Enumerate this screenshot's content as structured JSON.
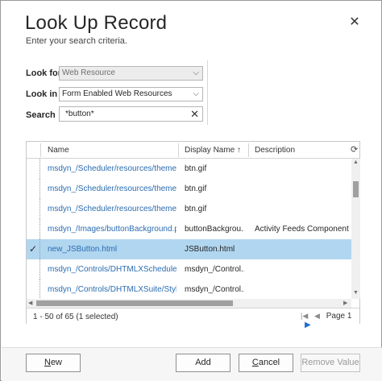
{
  "dialog": {
    "title": "Look Up Record",
    "subtitle": "Enter your search criteria.",
    "close_icon": "close-icon"
  },
  "criteria": {
    "look_for_label": "Look for",
    "look_for_value": "Web Resource",
    "look_in_label": "Look in",
    "look_in_value": "Form Enabled Web Resources",
    "search_label": "Search",
    "search_value": "*button*"
  },
  "grid": {
    "columns": {
      "name": "Name",
      "display_name": "Display Name",
      "sort_arrow": "↑",
      "description": "Description"
    },
    "refresh_icon": "refresh-icon",
    "rows": [
      {
        "name": "msdyn_/Scheduler/resources/themes...",
        "display_name": "btn.gif",
        "description": "",
        "selected": false
      },
      {
        "name": "msdyn_/Scheduler/resources/themes...",
        "display_name": "btn.gif",
        "description": "",
        "selected": false
      },
      {
        "name": "msdyn_/Scheduler/resources/themes...",
        "display_name": "btn.gif",
        "description": "",
        "selected": false
      },
      {
        "name": "msdyn_/Images/buttonBackground.p...",
        "display_name": "buttonBackgrou...",
        "description": "Activity Feeds Component",
        "selected": false
      },
      {
        "name": "new_JSButton.html",
        "display_name": "JSButton.html",
        "description": "",
        "selected": true
      },
      {
        "name": "msdyn_/Controls/DHTMLXScheduler...",
        "display_name": "msdyn_/Control...",
        "description": "",
        "selected": false
      },
      {
        "name": "msdyn_/Controls/DHTMLXSuite/Style...",
        "display_name": "msdyn_/Control...",
        "description": "",
        "selected": false
      }
    ],
    "record_count": "1 - 50 of 65 (1 selected)",
    "page_label": "Page 1",
    "check_mark": "✓"
  },
  "buttons": {
    "new_first": "N",
    "new_rest": "ew",
    "add": "Add",
    "cancel_first": "C",
    "cancel_rest": "ancel",
    "remove_value": "Remove Value"
  }
}
